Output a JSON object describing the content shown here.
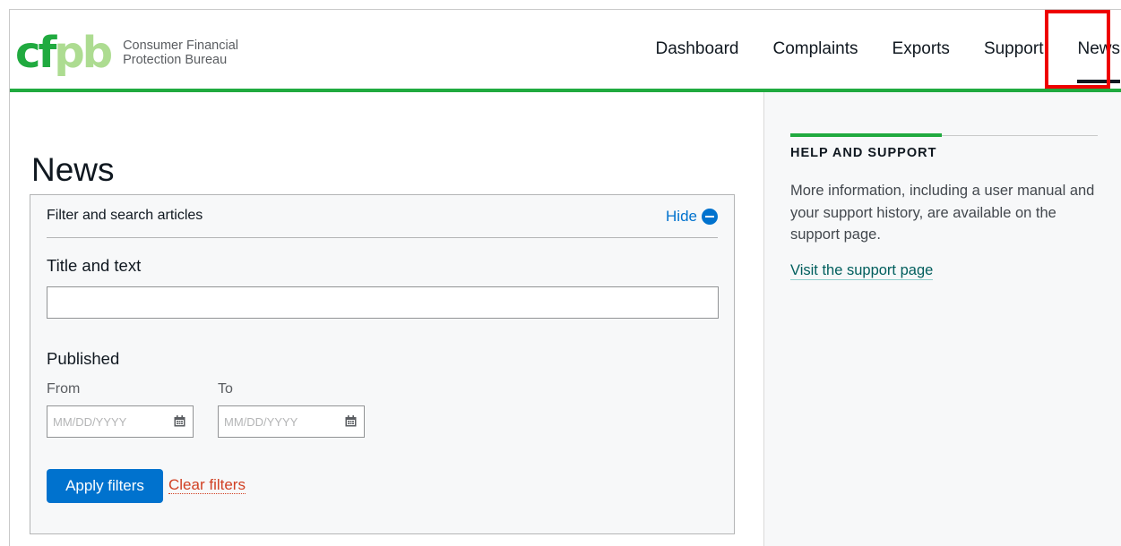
{
  "brand": {
    "logo_letters": [
      "c",
      "f",
      "p",
      "b"
    ],
    "name_line1": "Consumer Financial",
    "name_line2": "Protection Bureau",
    "colors": {
      "green": "#20aa3f",
      "light_green": "#addc91"
    }
  },
  "nav": {
    "items": [
      {
        "label": "Dashboard"
      },
      {
        "label": "Complaints"
      },
      {
        "label": "Exports"
      },
      {
        "label": "Support"
      },
      {
        "label": "News"
      }
    ],
    "active": "News",
    "highlight_color": "#ee0000"
  },
  "main": {
    "title": "News",
    "filter": {
      "header": "Filter and search articles",
      "toggle_label": "Hide",
      "toggle_icon": "minus-circle-icon",
      "title_text_label": "Title and text",
      "title_text_value": "",
      "published_label": "Published",
      "from_label": "From",
      "to_label": "To",
      "from_placeholder": "MM/DD/YYYY",
      "to_placeholder": "MM/DD/YYYY",
      "date_icon": "calendar-icon",
      "apply_label": "Apply filters",
      "clear_label": "Clear filters"
    }
  },
  "sidebar": {
    "title": "HELP AND SUPPORT",
    "text": "More information, including a user manual and your support history, are available on the support page.",
    "link": "Visit the support page"
  }
}
